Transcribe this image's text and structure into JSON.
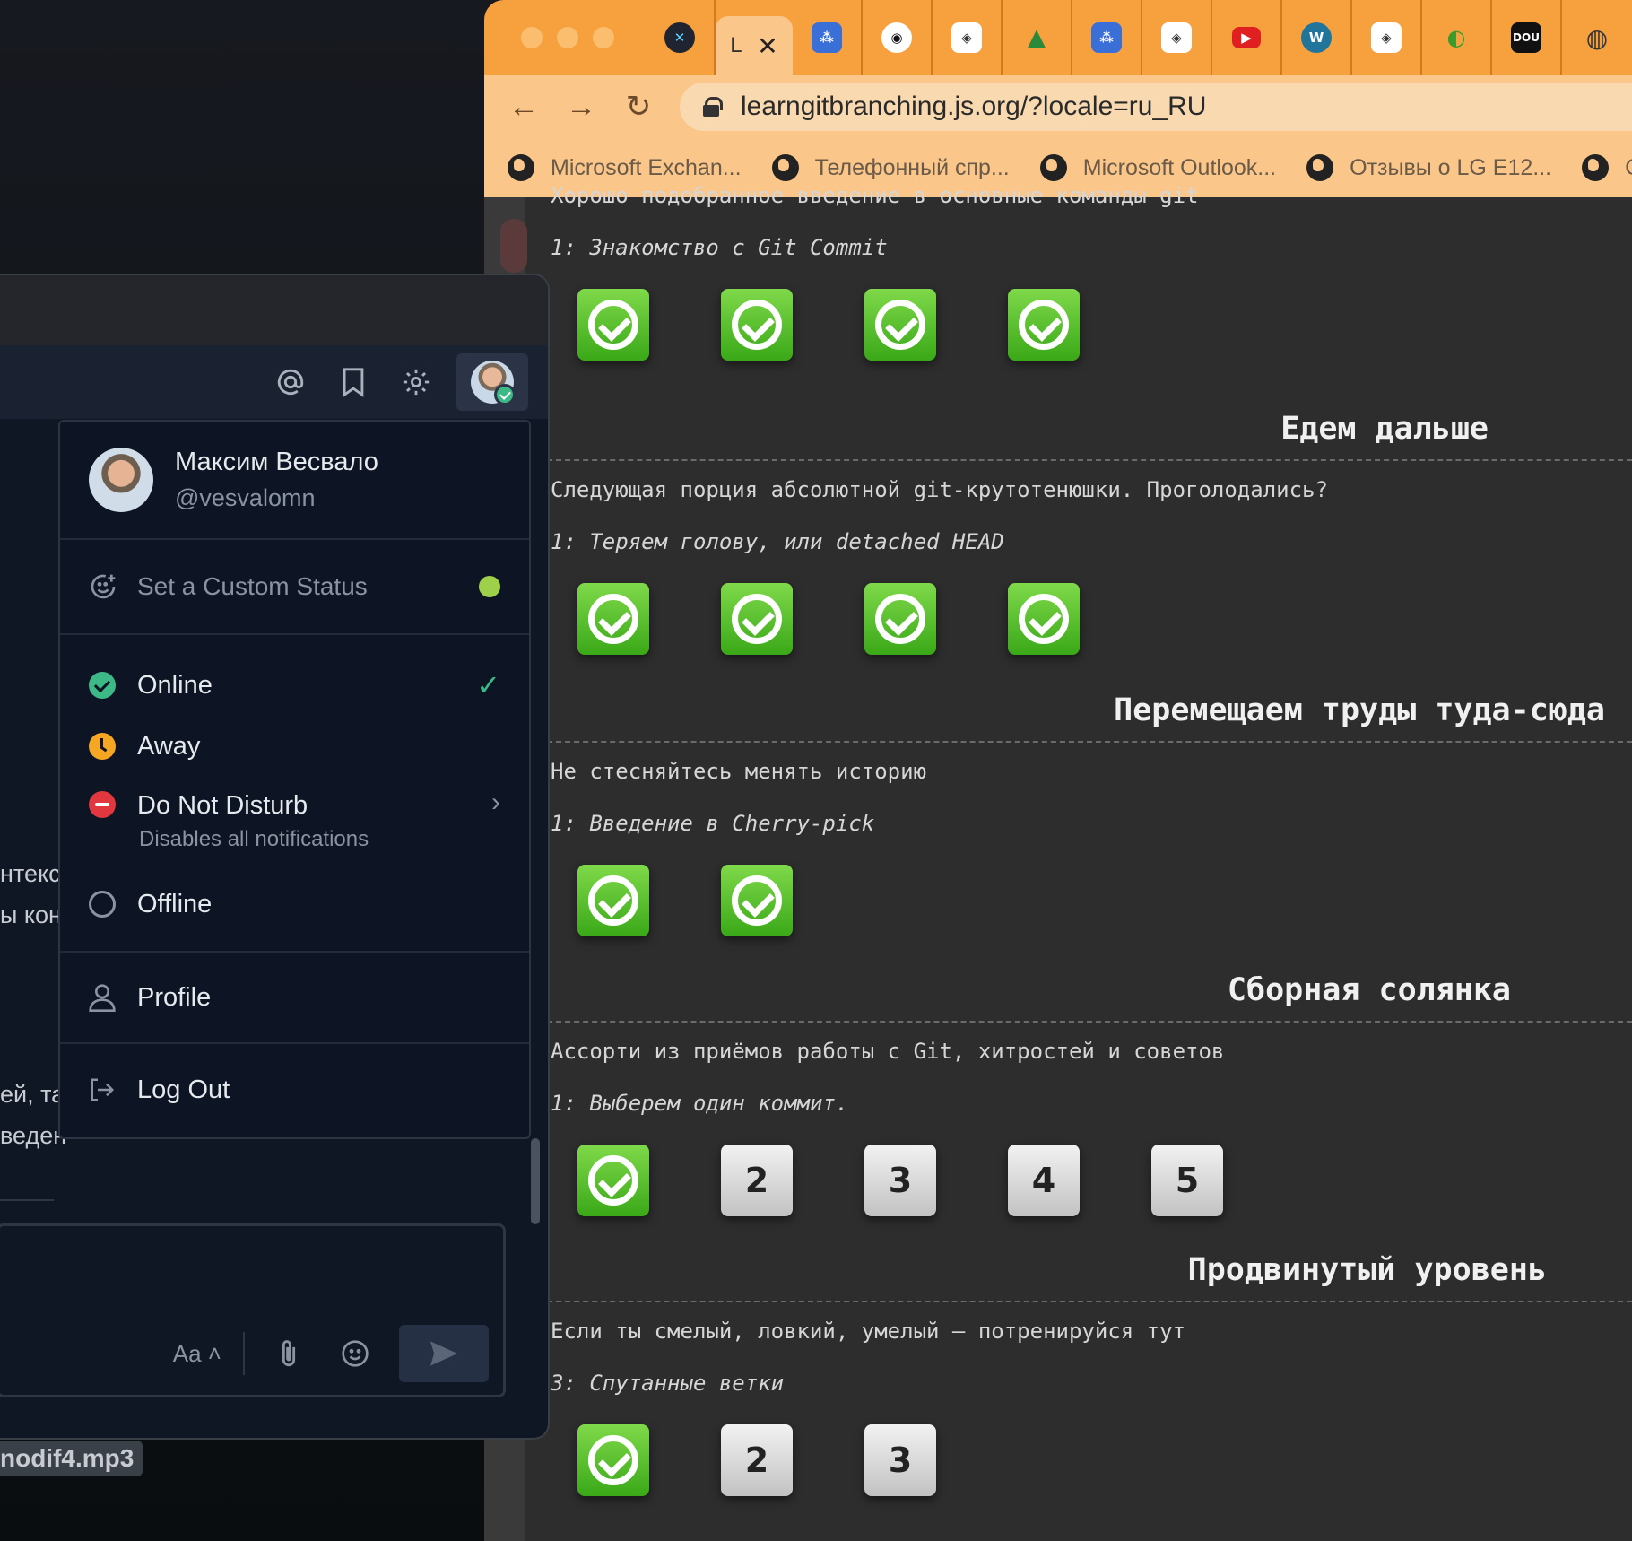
{
  "browser": {
    "active_tab_title": "L",
    "active_tab_close": "✕",
    "tab_favicons": [
      "devtools-icon",
      "git-branching-icon",
      "github-icon",
      "codewars-icon",
      "google-drive-icon",
      "git-branching-icon",
      "codewars-icon",
      "youtube-icon",
      "wordpress-icon",
      "codewars-icon",
      "extension-icon",
      "dou-icon",
      "chrome-icon"
    ],
    "dou_text": "DOU",
    "url": "learngitbranching.js.org/?locale=ru_RU",
    "bookmarks": [
      "Microsoft Exchan...",
      "Телефонный спр...",
      "Microsoft Outlook...",
      "Отзывы о LG E12..."
    ],
    "bookmark_tail": "C"
  },
  "page": {
    "intro_desc": "Хорошо подобранное введение в основные команды git",
    "sections": [
      {
        "title": "",
        "desc": "",
        "sub": "1: Знакомство с Git Commit",
        "levels": [
          "done",
          "done",
          "done",
          "done"
        ]
      },
      {
        "title": "Едем дальше",
        "desc": "Следующая порция абсолютной git-крутотенюшки. Проголодались?",
        "sub": "1: Теряем голову, или detached HEAD",
        "levels": [
          "done",
          "done",
          "done",
          "done"
        ]
      },
      {
        "title": "Перемещаем труды туда-сюда",
        "desc": "Не стесняйтесь менять историю",
        "sub": "1: Введение в Cherry-pick",
        "levels": [
          "done",
          "done"
        ]
      },
      {
        "title": "Сборная солянка",
        "desc": "Ассорти из приёмов работы с Git, хитростей и советов",
        "sub": "1: Выберем один коммит.",
        "levels": [
          "done",
          "2",
          "3",
          "4",
          "5"
        ]
      },
      {
        "title": "Продвинутый уровень",
        "desc": "Если ты смелый, ловкий, умелый — потренируйся тут",
        "sub": "3: Спутанные ветки",
        "levels": [
          "done",
          "2",
          "3"
        ]
      }
    ]
  },
  "chat": {
    "bg_fragments": [
      "нтекс",
      "ы кон",
      "ей, та",
      "веден"
    ],
    "user": {
      "name": "Максим Весвало",
      "handle": "@vesvalomn"
    },
    "custom_status": "Set a Custom Status",
    "statuses": [
      {
        "label": "Online",
        "sub": ""
      },
      {
        "label": "Away",
        "sub": ""
      },
      {
        "label": "Do Not Disturb",
        "sub": "Disables all notifications"
      },
      {
        "label": "Offline",
        "sub": ""
      }
    ],
    "profile": "Profile",
    "logout": "Log Out",
    "format_label": "Aa ˄",
    "file_chip": "nodif4.mp3"
  },
  "colors": {
    "accent_orange": "#f7a13e",
    "online": "#3db887",
    "away": "#f5a623",
    "dnd": "#e0383e",
    "level_done": "#5cbf2a"
  }
}
